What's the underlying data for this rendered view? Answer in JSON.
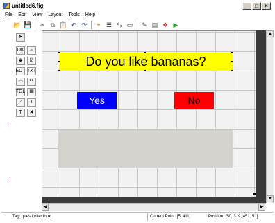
{
  "window": {
    "title": "untitled6.fig",
    "controls": [
      "_",
      "□",
      "×"
    ]
  },
  "menu": {
    "items": [
      {
        "key": "F",
        "rest": "ile"
      },
      {
        "key": "E",
        "rest": "dit"
      },
      {
        "key": "V",
        "rest": "iew"
      },
      {
        "key": "L",
        "rest": "ayout"
      },
      {
        "key": "T",
        "rest": "ools"
      },
      {
        "key": "H",
        "rest": "elp"
      }
    ]
  },
  "toolbar": {
    "icons": [
      {
        "name": "new-icon",
        "glyph": "🗋",
        "color": "#ffffff"
      },
      {
        "name": "open-icon",
        "glyph": "📂",
        "color": "#e0b040"
      },
      {
        "name": "save-icon",
        "glyph": "💾",
        "color": "#3050b0"
      },
      {
        "name": "cut-icon",
        "glyph": "✂",
        "color": "#606060"
      },
      {
        "name": "copy-icon",
        "glyph": "⧉",
        "color": "#606060"
      },
      {
        "name": "paste-icon",
        "glyph": "📋",
        "color": "#a08040"
      },
      {
        "name": "undo-icon",
        "glyph": "↶",
        "color": "#3050b0"
      },
      {
        "name": "redo-icon",
        "glyph": "↷",
        "color": "#3050b0"
      },
      {
        "name": "align-icon",
        "glyph": "⌖",
        "color": "#b08000"
      },
      {
        "name": "menu-editor-icon",
        "glyph": "☰",
        "color": "#404040"
      },
      {
        "name": "tab-order-icon",
        "glyph": "⇆",
        "color": "#404040"
      },
      {
        "name": "toolbar-editor-icon",
        "glyph": "▭",
        "color": "#404040"
      },
      {
        "name": "m-file-editor-icon",
        "glyph": "✎",
        "color": "#404040"
      },
      {
        "name": "property-inspector-icon",
        "glyph": "▤",
        "color": "#404040"
      },
      {
        "name": "object-browser-icon",
        "glyph": "❖",
        "color": "#c03030"
      },
      {
        "name": "run-icon",
        "glyph": "▶",
        "color": "#20a020"
      }
    ]
  },
  "palette": {
    "items": [
      {
        "name": "select-tool-icon",
        "glyph": "➤"
      },
      {
        "name": "push-button-tool-icon",
        "glyph": "OK"
      },
      {
        "name": "slider-tool-icon",
        "glyph": "⇔"
      },
      {
        "name": "radio-button-tool-icon",
        "glyph": "◉"
      },
      {
        "name": "checkbox-tool-icon",
        "glyph": "☑"
      },
      {
        "name": "edit-text-tool-icon",
        "glyph": "EDT"
      },
      {
        "name": "static-text-tool-icon",
        "glyph": "TXT"
      },
      {
        "name": "popup-menu-tool-icon",
        "glyph": "▭"
      },
      {
        "name": "listbox-tool-icon",
        "glyph": "☷"
      },
      {
        "name": "toggle-button-tool-icon",
        "glyph": "TGL"
      },
      {
        "name": "table-tool-icon",
        "glyph": "▦"
      },
      {
        "name": "axes-tool-icon",
        "glyph": "⟋"
      },
      {
        "name": "panel-tool-icon",
        "glyph": "T"
      },
      {
        "name": "button-group-tool-icon",
        "glyph": "T"
      },
      {
        "name": "activex-tool-icon",
        "glyph": "✖"
      }
    ]
  },
  "figure": {
    "question_text": "Do you like bananas?",
    "question_bg": "#ffff00",
    "yes_label": "Yes",
    "yes_bg": "#0000ff",
    "no_label": "No",
    "no_bg": "#ff0000",
    "panel_bg": "#d6d3ce"
  },
  "scroll": {
    "up": "▲",
    "down": "▼",
    "left": "◀",
    "right": "▶"
  },
  "status": {
    "tag": "Tag: questiontextbox",
    "current_point": "Current Point:  [5, 411]",
    "position": "Position: [50, 319, 451, 51]"
  }
}
